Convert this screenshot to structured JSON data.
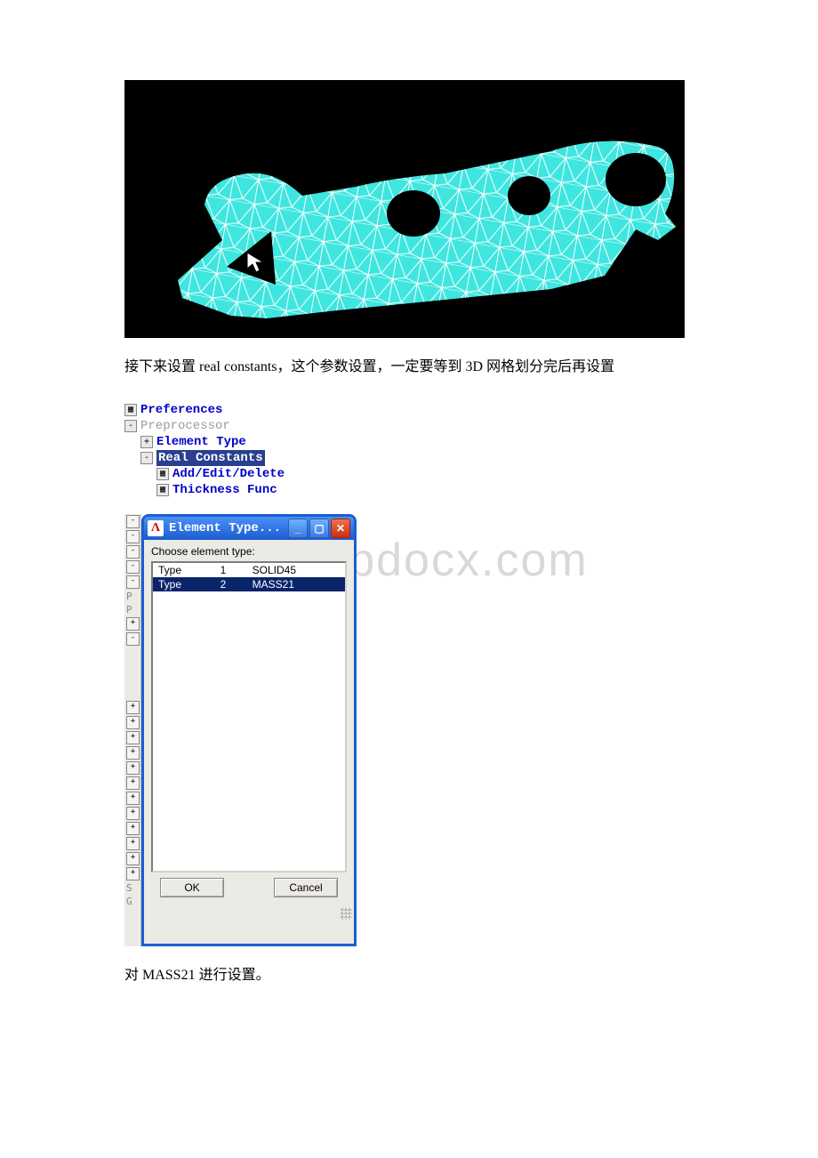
{
  "watermark": "www.bdocx.com",
  "para1": "接下来设置 real constants，这个参数设置，一定要等到 3D 网格划分完后再设置",
  "para2": "对 MASS21 进行设置。",
  "tree": {
    "preferences": "Preferences",
    "preprocessor": "Preprocessor",
    "elementType": "Element Type",
    "realConstants": "Real Constants",
    "addEditDelete": "Add/Edit/Delete",
    "thicknessFunc": "Thickness Func"
  },
  "dialog": {
    "title": "Element Type...",
    "choose": "Choose element type:",
    "rows": {
      "r1c1": "Type",
      "r1c2": "1",
      "r1c3": "SOLID45",
      "r2c1": "Type",
      "r2c2": "2",
      "r2c3": "MASS21"
    },
    "ok": "OK",
    "cancel": "Cancel"
  },
  "leftStrip": {
    "p1": "P",
    "p2": "P",
    "s": "S",
    "g": "G"
  }
}
